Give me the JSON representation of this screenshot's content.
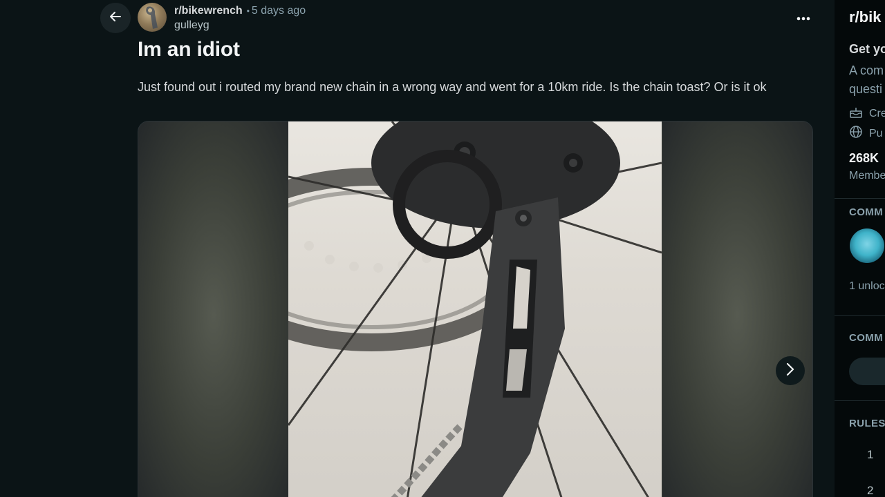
{
  "post": {
    "subreddit": "r/bikewrench",
    "separator": "•",
    "time_ago": "5 days ago",
    "author": "gulleyg",
    "title": "Im an idiot",
    "body": "Just found out i routed my brand new chain in a wrong way and went for a 10km ride. Is the chain toast? Or is it ok"
  },
  "icons": {
    "back": "arrow-left-icon",
    "more": "more-horizontal-icon",
    "next": "chevron-right-icon",
    "created": "cake-icon",
    "visibility": "globe-icon"
  },
  "sidebar": {
    "title": "r/bik",
    "tagline": "Get yo",
    "desc_line1": "A com",
    "desc_line2": "questi",
    "created_label": "Cre",
    "visibility_label": "Pu",
    "members_count": "268K",
    "members_label": "Membe",
    "section_achievements": "COMM",
    "achievements_unlocked": "1 unloc",
    "section_community": "COMM",
    "section_rules": "RULES",
    "rules": [
      "1",
      "2"
    ]
  },
  "colors": {
    "background": "#0b1416",
    "sidebar_background": "#04090a",
    "text_primary": "#f2f4f5",
    "text_secondary": "#8ba2ad"
  }
}
